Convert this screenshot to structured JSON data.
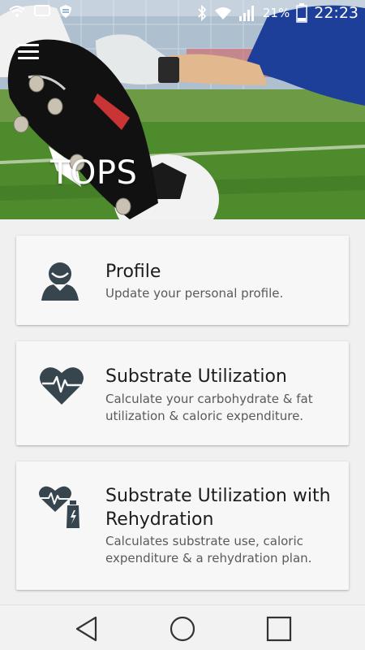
{
  "status_bar": {
    "battery_percent": "21%",
    "time": "22:23",
    "icons": [
      "wifi-alert-icon",
      "screen-icon",
      "shield-icon",
      "bluetooth-icon",
      "wifi-icon",
      "signal-icon",
      "battery-icon"
    ]
  },
  "header": {
    "menu_icon": "menu-icon",
    "title": "TOPS"
  },
  "cards": [
    {
      "icon": "person-icon",
      "title": "Profile",
      "description": "Update your personal profile."
    },
    {
      "icon": "heart-pulse-icon",
      "title": "Substrate Utilization",
      "description": "Calculate your carbohydrate & fat utilization & caloric expenditure."
    },
    {
      "icon": "heart-bottle-icon",
      "title": "Substrate Utilization with Rehydration",
      "description": "Calculates substrate use, caloric expenditure & a rehydration plan."
    }
  ],
  "colors": {
    "icon_color": "#37454f",
    "card_background": "#f7f7f7",
    "page_background": "#f0f0f0",
    "title_text": "#1c1c1c",
    "description_text": "#5a5a5a"
  },
  "navigation_bar": {
    "icons": [
      "back-icon",
      "home-icon",
      "recent-apps-icon"
    ]
  }
}
